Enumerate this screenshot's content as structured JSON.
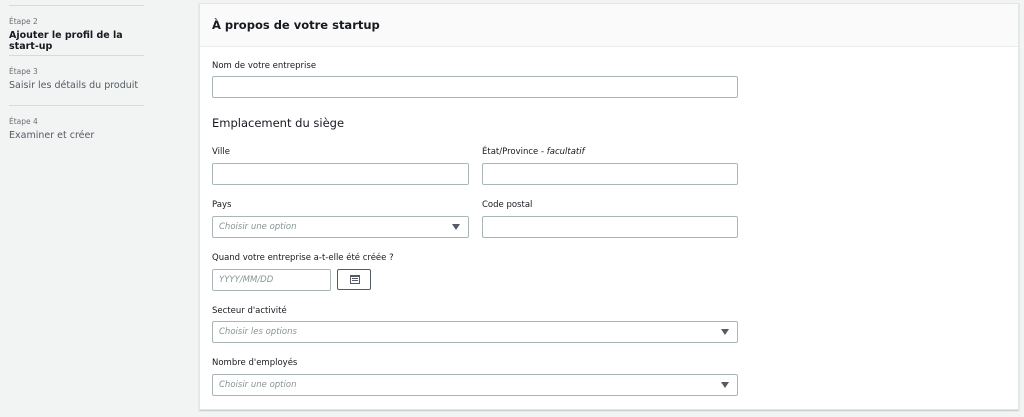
{
  "sidebar": {
    "steps": [
      {
        "number": "Étape 2",
        "label": "Ajouter le profil de la start-up",
        "active": true
      },
      {
        "number": "Étape 3",
        "label": "Saisir les détails du produit",
        "active": false
      },
      {
        "number": "Étape 4",
        "label": "Examiner et créer",
        "active": false
      }
    ]
  },
  "panel": {
    "title": "À propos de votre startup",
    "company_name": {
      "label": "Nom de votre entreprise",
      "value": ""
    },
    "headquarters": {
      "title": "Emplacement du siège",
      "city": {
        "label": "Ville",
        "value": ""
      },
      "state": {
        "label": "État/Province - ",
        "optional": "facultatif",
        "value": ""
      },
      "country": {
        "label": "Pays",
        "placeholder": "Choisir une option"
      },
      "postal_code": {
        "label": "Code postal",
        "value": ""
      }
    },
    "founded": {
      "label": "Quand votre entreprise a-t-elle été créée ?",
      "placeholder": "YYYY/MM/DD"
    },
    "industry": {
      "label": "Secteur d'activité",
      "placeholder": "Choisir les options"
    },
    "employees": {
      "label": "Nombre d'employés",
      "placeholder": "Choisir une option"
    }
  }
}
